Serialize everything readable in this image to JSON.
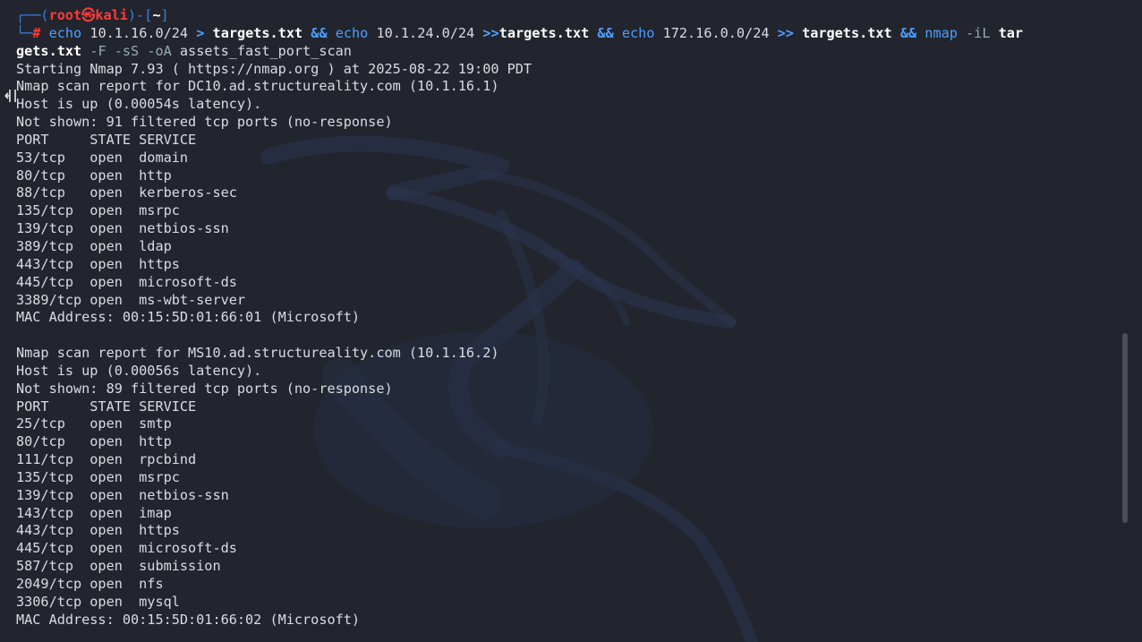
{
  "prompt": {
    "frame_top_left": "┌──(",
    "user": "root",
    "skull": "㉿",
    "host": "kali",
    "frame_mid": ")-[",
    "dir": "~",
    "frame_end": "]",
    "frame_bottom": "└─",
    "hash": "#"
  },
  "command": {
    "echo1": "echo",
    "net1": "10.1.16.0/24",
    "redir1": ">",
    "file1": "targets.txt",
    "and1": "&&",
    "echo2": "echo",
    "net2": "10.1.24.0/24",
    "redir2": ">>",
    "file2": "targets.txt",
    "and2": "&&",
    "echo3": "echo",
    "net3": "172.16.0.0/24",
    "redir3": ">>",
    "file3": "targets.txt",
    "and3": "&&",
    "nmap": "nmap",
    "flag_il": "-iL",
    "file4_part1": "tar",
    "file4_part2": "gets.txt",
    "flags": "-F -sS -oA",
    "outfile": "assets_fast_port_scan"
  },
  "output_lines": [
    "Starting Nmap 7.93 ( https://nmap.org ) at 2025-08-22 19:00 PDT",
    "Nmap scan report for DC10.ad.structureality.com (10.1.16.1)",
    "Host is up (0.00054s latency).",
    "Not shown: 91 filtered tcp ports (no-response)",
    "PORT     STATE SERVICE",
    "53/tcp   open  domain",
    "80/tcp   open  http",
    "88/tcp   open  kerberos-sec",
    "135/tcp  open  msrpc",
    "139/tcp  open  netbios-ssn",
    "389/tcp  open  ldap",
    "443/tcp  open  https",
    "445/tcp  open  microsoft-ds",
    "3389/tcp open  ms-wbt-server",
    "MAC Address: 00:15:5D:01:66:01 (Microsoft)",
    "",
    "Nmap scan report for MS10.ad.structureality.com (10.1.16.2)",
    "Host is up (0.00056s latency).",
    "Not shown: 89 filtered tcp ports (no-response)",
    "PORT     STATE SERVICE",
    "25/tcp   open  smtp",
    "80/tcp   open  http",
    "111/tcp  open  rpcbind",
    "135/tcp  open  msrpc",
    "139/tcp  open  netbios-ssn",
    "143/tcp  open  imap",
    "443/tcp  open  https",
    "445/tcp  open  microsoft-ds",
    "587/tcp  open  submission",
    "2049/tcp open  nfs",
    "3306/tcp open  mysql",
    "MAC Address: 00:15:5D:01:66:02 (Microsoft)"
  ],
  "colors": {
    "background": "#22252d",
    "prompt_frame": "#3c7cdc",
    "prompt_user": "#ff3b3b",
    "command": "#4f9fff",
    "text": "#d9dde3"
  }
}
